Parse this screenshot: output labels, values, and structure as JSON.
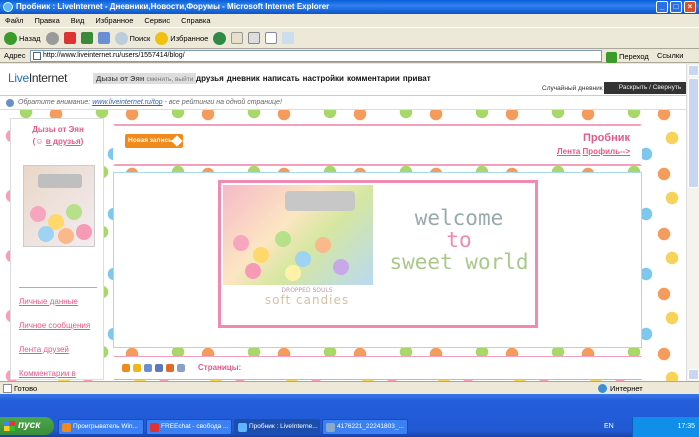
{
  "window": {
    "title": "Пробник : LiveInternet - Дневники,Новости,Форумы - Microsoft Internet Explorer"
  },
  "menu": [
    "Файл",
    "Правка",
    "Вид",
    "Избранное",
    "Сервис",
    "Справка"
  ],
  "toolbar": {
    "back_label": "Назад",
    "search_label": "Поиск",
    "favorites_label": "Избранное"
  },
  "address": {
    "label": "Адрес",
    "url": "http://www.liveinternet.ru/users/1557414/blog/",
    "go_label": "Переход",
    "links_label": "Ссылки"
  },
  "li_header": {
    "logo_live": "Live",
    "logo_internet": "Internet",
    "user_name": "Дызы от Эян",
    "user_switch": "сменить, выйти",
    "nav": [
      "друзья",
      "дневник",
      "написать",
      "настройки",
      "комментарии",
      "приват"
    ],
    "random_diary": "Случайный дневник //",
    "expand_label": "Раскрыть / Свернуть"
  },
  "notice": {
    "prefix": "Обратите внимание:",
    "link": "www.liveinternet.ru/top",
    "suffix": "- все рейтинги на одной странице!"
  },
  "sidebar": {
    "title": "Дызы от Эян",
    "friend_label": "в друзья",
    "links": [
      "Личные данные",
      "Личное сообщения",
      "Лента друзей",
      "Комментарии в дневнике"
    ]
  },
  "blog": {
    "new_post": "Новая запись",
    "title": "Пробник",
    "nav_feed": "Лента",
    "nav_profile": "Профиль-->"
  },
  "banner": {
    "line1": "welcome",
    "line2": "to",
    "line3": "sweet world",
    "brand_small": "DROPPED SOULS",
    "brand_large": "soft candies"
  },
  "pager": {
    "label": "Страницы:"
  },
  "status": {
    "ready": "Готово",
    "zone": "Интернет"
  },
  "taskbar": {
    "start": "пуск",
    "tasks": [
      "Проигрыватель Win...",
      "FREEchat - свобода ...",
      "Пробник : LiveInterne...",
      "4176221_22241803_..."
    ],
    "lang": "EN",
    "clock": "17:35"
  }
}
